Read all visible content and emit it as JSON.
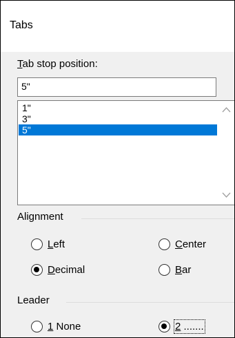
{
  "dialog": {
    "title": "Tabs"
  },
  "tab_stop": {
    "label_accel": "T",
    "label_rest": "ab stop position:",
    "value": "5\"",
    "list": [
      "1\"",
      "3\"",
      "5\""
    ],
    "selected_index": 2
  },
  "alignment": {
    "group_label": "Alignment",
    "options": [
      {
        "accel": "L",
        "rest": "eft",
        "checked": false
      },
      {
        "accel": "C",
        "rest": "enter",
        "checked": false
      },
      {
        "accel": "D",
        "rest": "ecimal",
        "checked": true
      },
      {
        "accel": "B",
        "rest": "ar",
        "checked": false
      }
    ]
  },
  "leader": {
    "group_label": "Leader",
    "options": [
      {
        "accel": "1",
        "rest": " None",
        "checked": false
      },
      {
        "accel": "2",
        "rest": " .......",
        "checked": true
      }
    ]
  },
  "colors": {
    "selection": "#0078d7",
    "dialog_bg": "#f0f0f0"
  }
}
